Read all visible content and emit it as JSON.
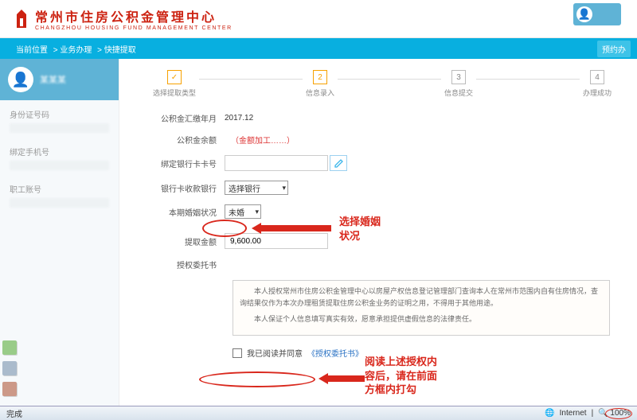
{
  "header": {
    "org_cn": "常州市住房公积金管理中心",
    "org_en": "CHANGZHOU HOUSING FUND MANAGEMENT CENTER"
  },
  "breadcrumb": {
    "a": "当前位置",
    "b": "业务办理",
    "c": "快捷提取"
  },
  "topbutton": "预约办",
  "sidebar": {
    "username": "某某某",
    "f1": "身份证号码",
    "f2": "绑定手机号",
    "f3": "职工账号"
  },
  "steps": {
    "s1": "选择提取类型",
    "s2": "信息录入",
    "s3": "信息提交",
    "s4": "办理成功",
    "n2": "2",
    "n3": "3",
    "n4": "4"
  },
  "form": {
    "l_month": "公积金汇缴年月",
    "v_month": "2017.12",
    "l_balance": "公积金余额",
    "v_balance_hint": "（金额加工……）",
    "l_card": "绑定银行卡卡号",
    "l_bank": "银行卡收款银行",
    "v_bank": "选择银行",
    "l_marital": "本期婚姻状况",
    "v_marital": "未婚",
    "l_amount": "提取金额",
    "v_amount": "9,600.00",
    "l_auth": "授权委托书"
  },
  "auth": {
    "p1": "本人授权常州市住房公积金管理中心以房屋产权信息登记管理部门查询本人在常州市范围内自有住房情况，查询结果仅作为本次办理租赁提取住房公积金业务的证明之用，不得用于其他用途。",
    "p2": "本人保证个人信息填写真实有效，愿意承担提供虚假信息的法律责任。"
  },
  "agree": {
    "text": "我已阅读并同意",
    "link": "《授权委托书》"
  },
  "anno": {
    "marital": "选择婚姻\n状况",
    "read": "阅读上述授权内\n容后，请在前面\n方框内打勾"
  },
  "status": {
    "done": "完成",
    "net": "Internet",
    "zoom": "100"
  }
}
